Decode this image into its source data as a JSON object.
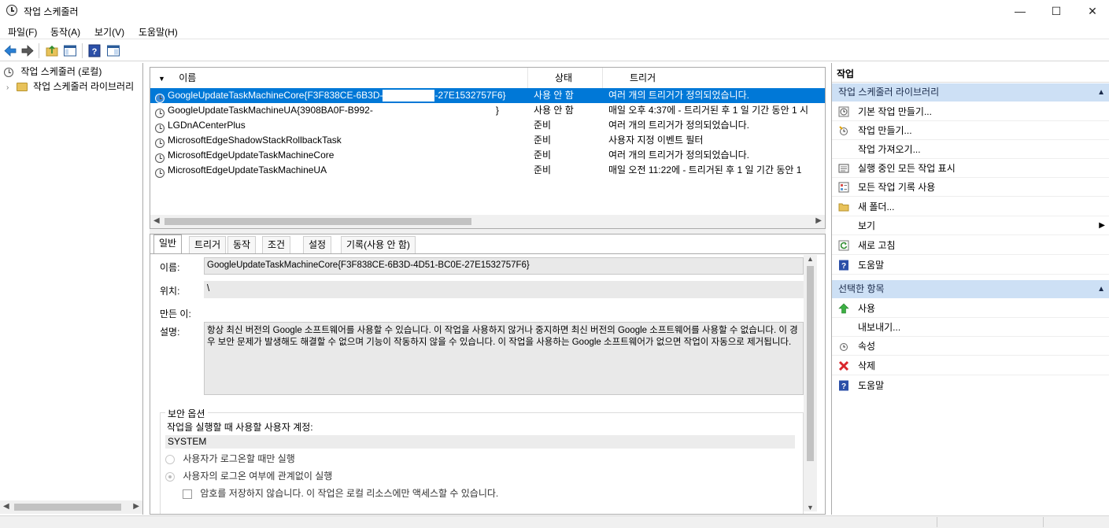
{
  "window": {
    "title": "작업 스케줄러"
  },
  "menu": [
    "파일(F)",
    "동작(A)",
    "보기(V)",
    "도움말(H)"
  ],
  "tree": {
    "root": "작업 스케줄러 (로컬)",
    "child": "작업 스케줄러 라이브러리"
  },
  "task_list": {
    "columns": {
      "name": "이름",
      "status": "상태",
      "trigger": "트리거"
    },
    "rows": [
      {
        "name": "GoogleUpdateTaskMachineCore{F3F838CE-6B3D-",
        "name_tail": "-27E1532757F6}",
        "status": "사용 안 함",
        "trigger": "여러 개의 트리거가 정의되었습니다."
      },
      {
        "name": "GoogleUpdateTaskMachineUA{3908BA0F-B992-",
        "name_tail": "}",
        "status": "사용 안 함",
        "trigger": "매일 오후 4:37에 - 트리거된 후 1 일 기간 동안 1 시"
      },
      {
        "name": "LGDnACenterPlus",
        "name_tail": "",
        "status": "준비",
        "trigger": "여러 개의 트리거가 정의되었습니다."
      },
      {
        "name": "MicrosoftEdgeShadowStackRollbackTask",
        "name_tail": "",
        "status": "준비",
        "trigger": "사용자 지정 이벤트 필터"
      },
      {
        "name": "MicrosoftEdgeUpdateTaskMachineCore",
        "name_tail": "",
        "status": "준비",
        "trigger": "여러 개의 트리거가 정의되었습니다."
      },
      {
        "name": "MicrosoftEdgeUpdateTaskMachineUA",
        "name_tail": "",
        "status": "준비",
        "trigger": "매일 오전 11:22에 - 트리거된 후 1 일 기간 동안 1"
      }
    ]
  },
  "detail": {
    "tabs": [
      "일반",
      "트리거",
      "동작",
      "조건",
      "설정",
      "기록(사용 안 함)"
    ],
    "labels": {
      "name": "이름:",
      "location": "위치:",
      "author": "만든 이:",
      "description": "설명:"
    },
    "name_value": "GoogleUpdateTaskMachineCore{F3F838CE-6B3D-4D51-BC0E-27E1532757F6}",
    "location_value": "\\",
    "author_value": "",
    "description_value": "항상 최신 버전의 Google 소프트웨어를 사용할 수 있습니다. 이 작업을 사용하지 않거나 중지하면 최신 버전의 Google 소프트웨어를 사용할 수 없습니다. 이 경우 보안 문제가 발생해도 해결할 수 없으며 기능이 작동하지 않을 수 있습니다. 이 작업을 사용하는 Google 소프트웨어가 없으면 작업이 자동으로 제거됩니다.",
    "security": {
      "legend": "보안 옵션",
      "account_label": "작업을 실행할 때 사용할 사용자 계정:",
      "account_value": "SYSTEM",
      "radio_logged_on": "사용자가 로그온할 때만 실행",
      "radio_any": "사용자의 로그온 여부에 관계없이 실행",
      "checkbox_no_password": "암호를 저장하지 않습니다. 이 작업은 로컬 리소스에만 액세스할 수 있습니다."
    }
  },
  "actions_pane": {
    "title": "작업",
    "section1": "작업 스케줄러 라이브러리",
    "section1_items": [
      "기본 작업 만들기...",
      "작업 만들기...",
      "작업 가져오기...",
      "실행 중인 모든 작업 표시",
      "모든 작업 기록 사용",
      "새 폴더...",
      "보기",
      "새로 고침",
      "도움말"
    ],
    "section2": "선택한 항목",
    "section2_items": [
      "사용",
      "내보내기...",
      "속성",
      "삭제",
      "도움말"
    ]
  },
  "colors": {
    "selection": "#0078d7",
    "section_bg": "#cde0f5"
  }
}
